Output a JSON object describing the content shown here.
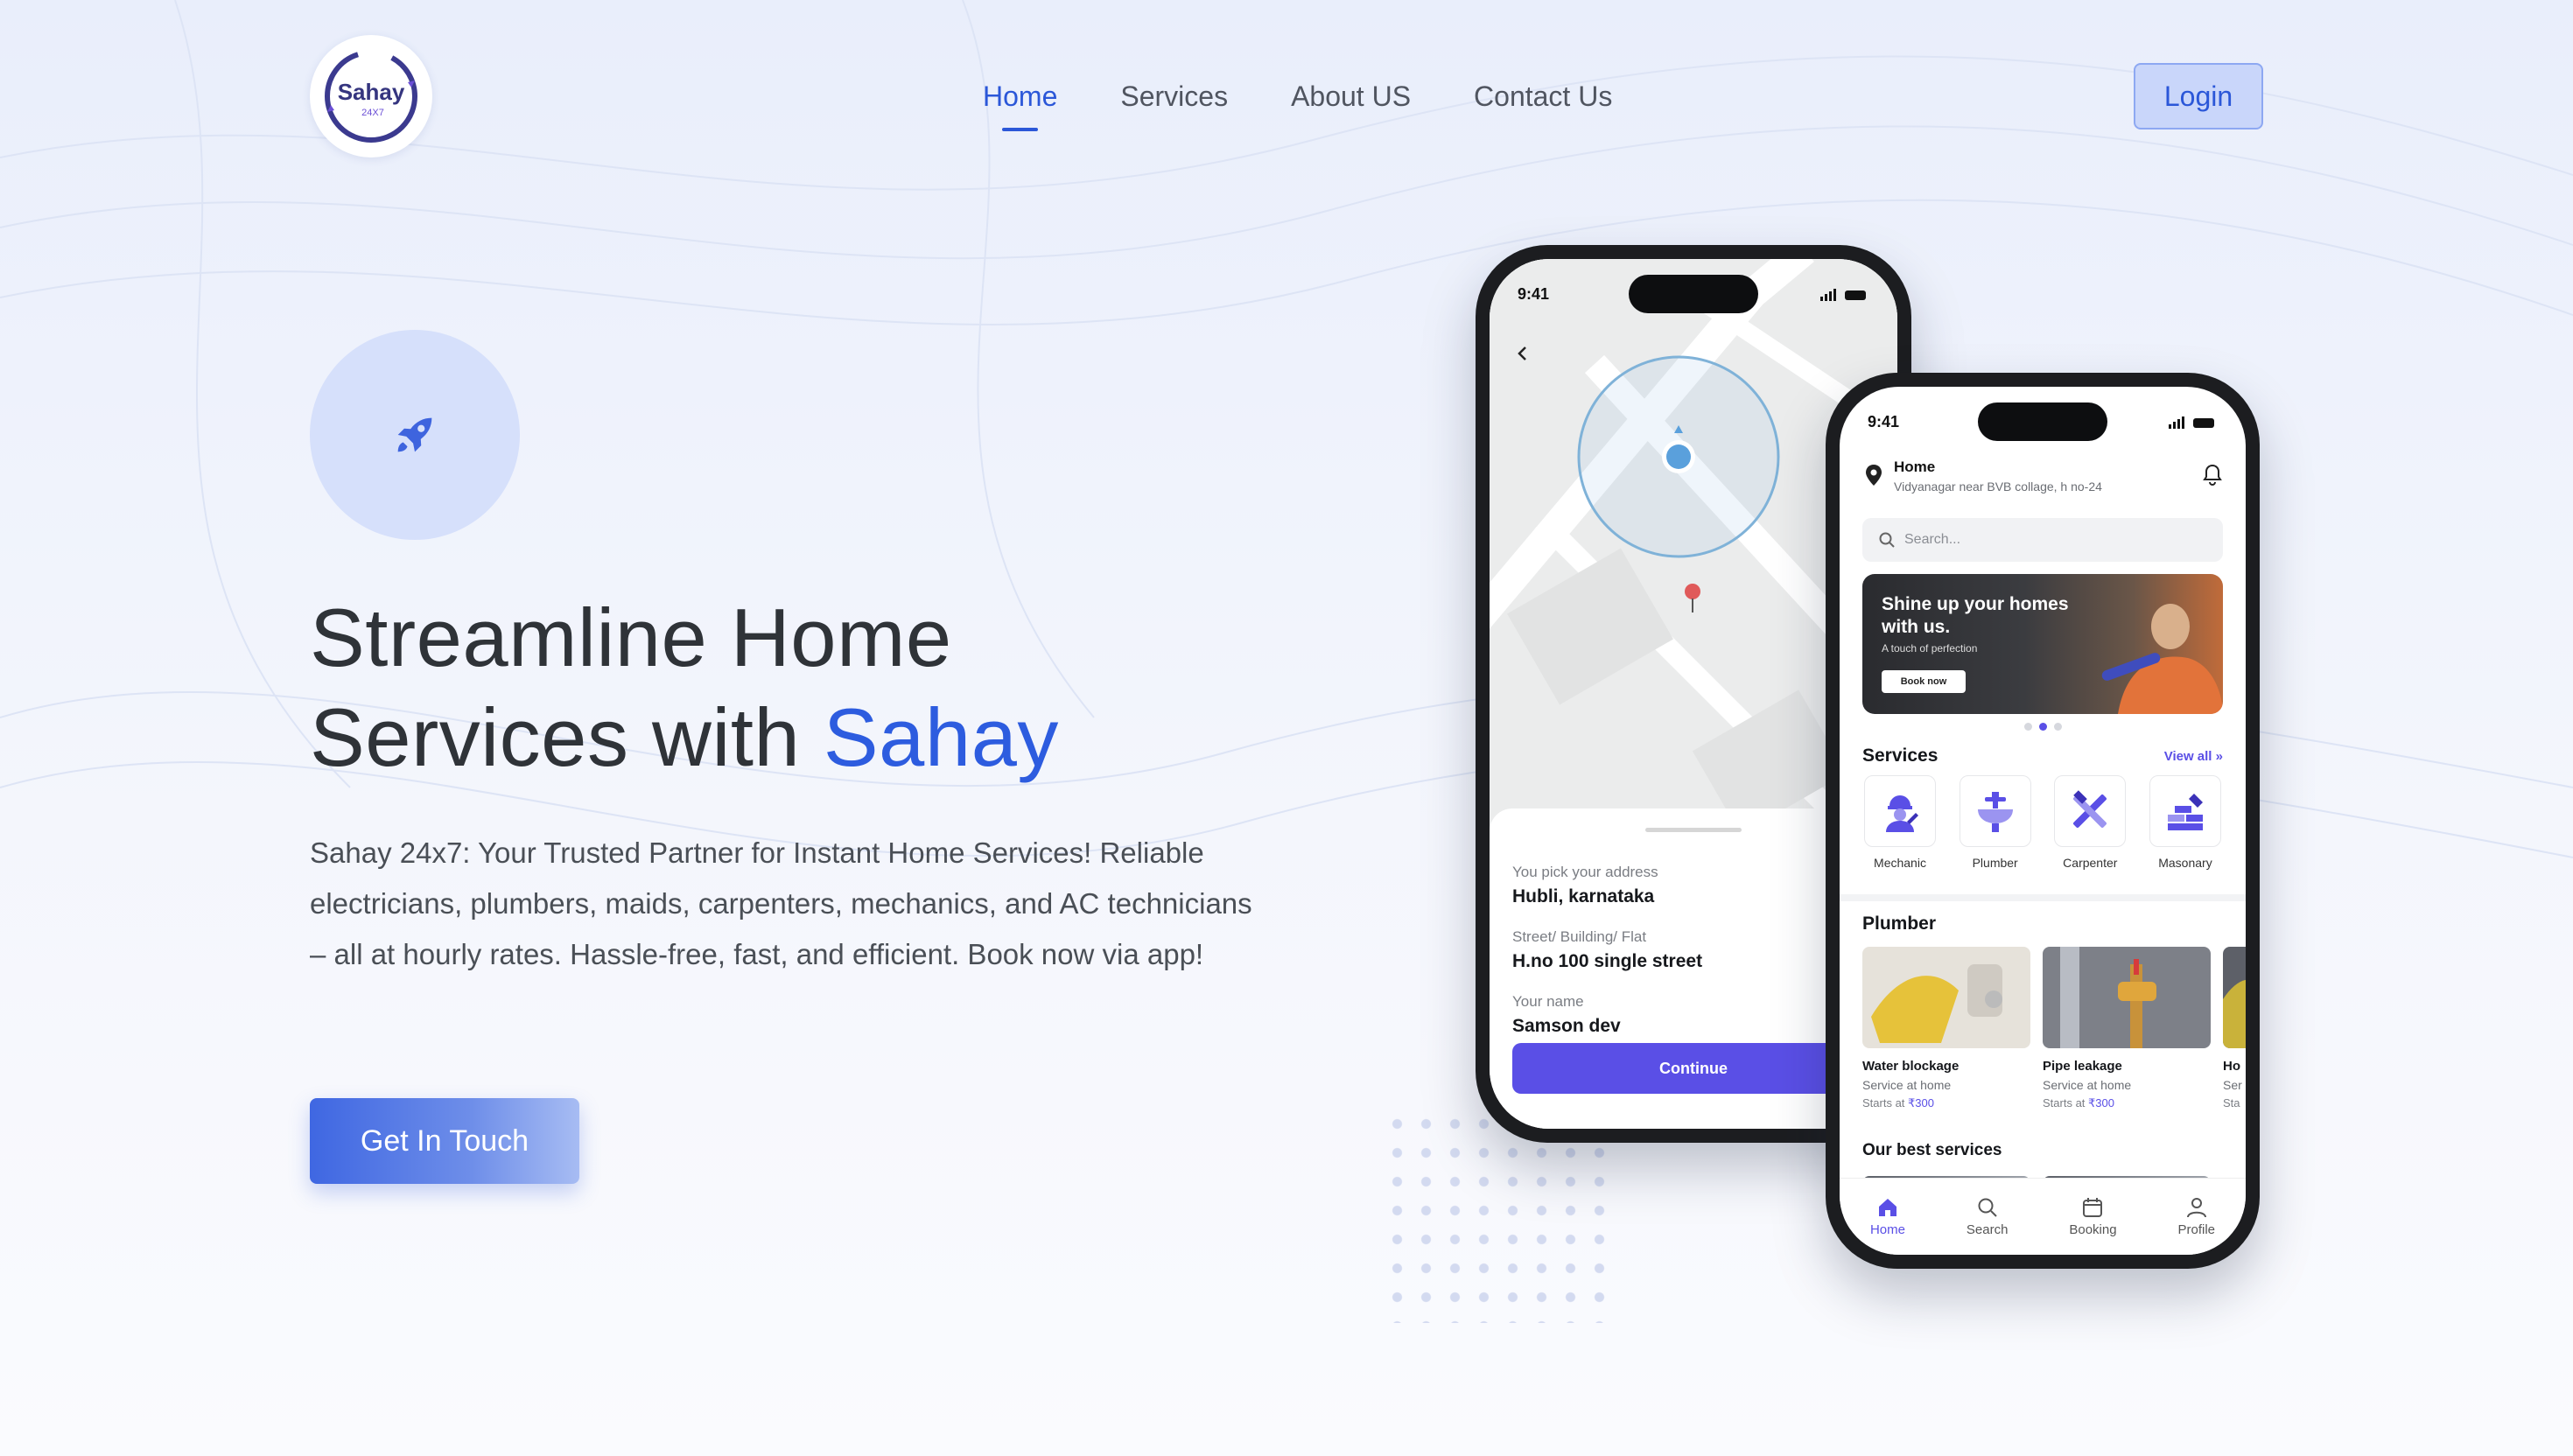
{
  "brand": {
    "logo_text": "Sahay",
    "logo_sub": "24X7"
  },
  "nav": {
    "items": [
      "Home",
      "Services",
      "About US",
      "Contact Us"
    ],
    "active": "Home"
  },
  "header": {
    "login_label": "Login"
  },
  "hero": {
    "title_line1": "Streamline Home",
    "title_line2_prefix": "Services with ",
    "title_line2_accent": "Sahay",
    "description": "Sahay 24x7: Your Trusted Partner for Instant Home Services! Reliable electricians, plumbers, maids, carpenters, mechanics, and AC technicians – all at hourly rates. Hassle-free, fast, and efficient. Book now via app!",
    "cta_label": "Get In Touch",
    "badge_icon": "rocket-icon"
  },
  "phone_address": {
    "time": "9:41",
    "fields": [
      {
        "label": "You pick your address",
        "value": "Hubli, karnataka"
      },
      {
        "label": "Street/ Building/ Flat",
        "value": "H.no 100 single street"
      },
      {
        "label": "Your name",
        "value": "Samson dev"
      }
    ],
    "continue_label": "Continue"
  },
  "phone_home": {
    "time": "9:41",
    "location_title": "Home",
    "location_sub": "Vidyanagar near BVB collage, h no-24",
    "search_placeholder": "Search...",
    "banner": {
      "title": "Shine up your homes with us.",
      "subtitle": "A touch of perfection",
      "button": "Book now"
    },
    "services_title": "Services",
    "view_all": "View all",
    "services": [
      "Mechanic",
      "Plumber",
      "Carpenter",
      "Masonary"
    ],
    "plumber_title": "Plumber",
    "cards": [
      {
        "title": "Water blockage",
        "sub": "Service at home",
        "price_prefix": "Starts at ",
        "price": "₹300"
      },
      {
        "title": "Pipe leakage",
        "sub": "Service at home",
        "price_prefix": "Starts at ",
        "price": "₹300"
      },
      {
        "title": "Ho",
        "sub": "Ser",
        "price_prefix": "Sta",
        "price": ""
      }
    ],
    "best_title": "Our best services",
    "tabs": [
      "Home",
      "Search",
      "Booking",
      "Profile"
    ],
    "active_tab": "Home"
  },
  "colors": {
    "accent": "#2d5cdf",
    "app_primary": "#5a4fe6",
    "background": "#eef2fc"
  }
}
